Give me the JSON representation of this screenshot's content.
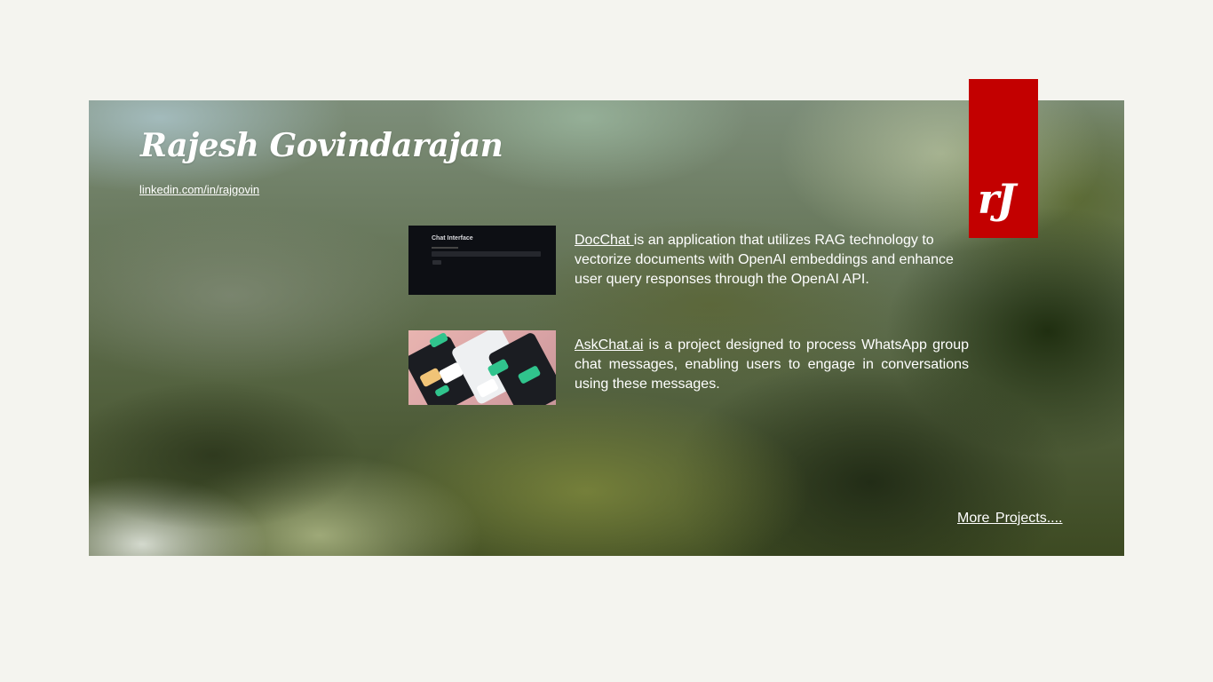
{
  "profile": {
    "name": "Rajesh Govindarajan",
    "linkedin": "linkedin.com/in/rajgovin"
  },
  "logo": {
    "text": "rJ",
    "color": "#c30000"
  },
  "projects": [
    {
      "link_text": "DocChat ",
      "description": "is an application that utilizes RAG technology to vectorize documents with OpenAI embeddings and enhance user query responses through the OpenAI API.",
      "thumbnail": {
        "title": "Chat Interface"
      }
    },
    {
      "link_text": "AskChat.ai",
      "description": " is a project designed to process WhatsApp group chat messages, enabling users to engage in conversations using these messages."
    }
  ],
  "more_projects": "More  Projects...."
}
